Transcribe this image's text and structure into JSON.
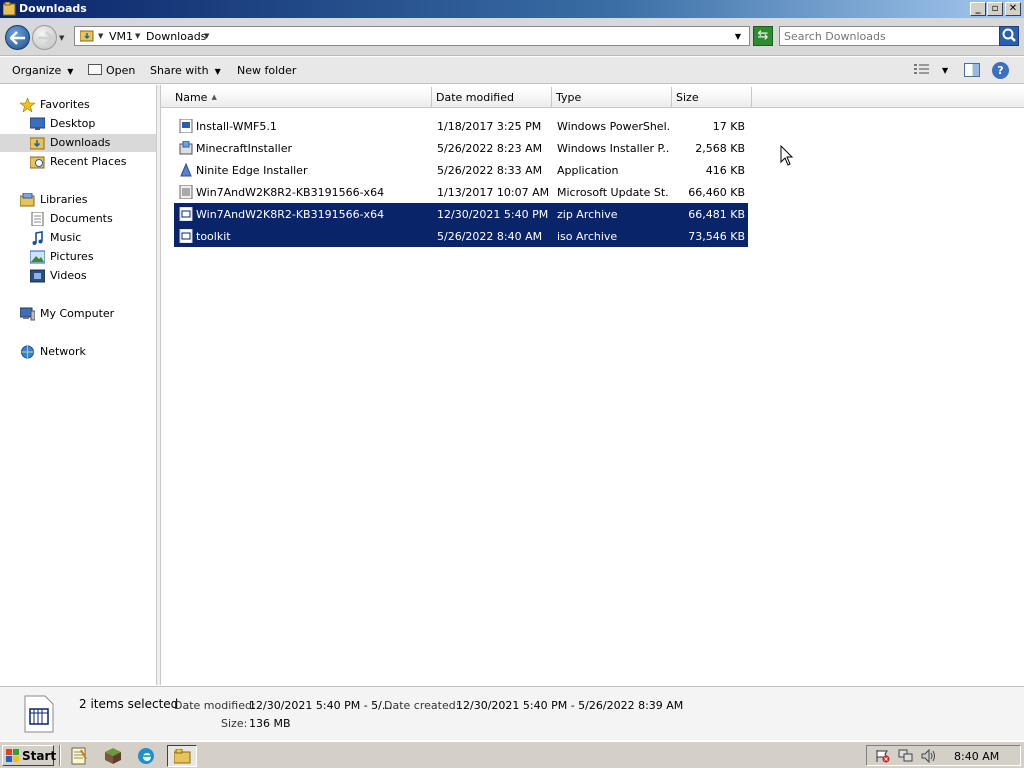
{
  "window": {
    "title": "Downloads"
  },
  "nav": {
    "back_icon": "back-arrow-icon",
    "forward_icon": "forward-arrow-icon"
  },
  "address": {
    "crumbs": [
      "VM1",
      "Downloads"
    ]
  },
  "search": {
    "placeholder": "Search Downloads"
  },
  "toolbar": {
    "organize": "Organize",
    "open": "Open",
    "share_with": "Share with",
    "new_folder": "New folder"
  },
  "sidebar": {
    "favorites": "Favorites",
    "desktop": "Desktop",
    "downloads": "Downloads",
    "recent_places": "Recent Places",
    "libraries": "Libraries",
    "documents": "Documents",
    "music": "Music",
    "pictures": "Pictures",
    "videos": "Videos",
    "my_computer": "My Computer",
    "network": "Network",
    "selected": "downloads"
  },
  "columns": {
    "name": "Name",
    "date_modified": "Date modified",
    "type": "Type",
    "size": "Size"
  },
  "files": [
    {
      "name": "Install-WMF5.1",
      "date": "1/18/2017 3:25 PM",
      "type": "Windows PowerShel...",
      "size": "17 KB",
      "icon": "powershell-script-icon",
      "selected": false
    },
    {
      "name": "MinecraftInstaller",
      "date": "5/26/2022 8:23 AM",
      "type": "Windows Installer P...",
      "size": "2,568 KB",
      "icon": "installer-package-icon",
      "selected": false
    },
    {
      "name": "Ninite Edge Installer",
      "date": "5/26/2022 8:33 AM",
      "type": "Application",
      "size": "416 KB",
      "icon": "application-icon",
      "selected": false
    },
    {
      "name": "Win7AndW2K8R2-KB3191566-x64",
      "date": "1/13/2017 10:07 AM",
      "type": "Microsoft Update St...",
      "size": "66,460 KB",
      "icon": "update-package-icon",
      "selected": false
    },
    {
      "name": "Win7AndW2K8R2-KB3191566-x64",
      "date": "12/30/2021 5:40 PM",
      "type": "zip Archive",
      "size": "66,481 KB",
      "icon": "archive-icon",
      "selected": true
    },
    {
      "name": "toolkit",
      "date": "5/26/2022 8:40 AM",
      "type": "iso Archive",
      "size": "73,546 KB",
      "icon": "archive-icon",
      "selected": true
    }
  ],
  "details": {
    "count": "2 items selected",
    "date_modified_label": "Date modified:",
    "date_modified_value": "12/30/2021 5:40 PM - 5/...",
    "date_created_label": "Date created:",
    "date_created_value": "12/30/2021 5:40 PM - 5/26/2022 8:39 AM",
    "size_label": "Size:",
    "size_value": "136 MB"
  },
  "taskbar": {
    "start": "Start",
    "clock": "8:40 AM"
  },
  "colors": {
    "selection": "#0a246a",
    "title_start": "#0a246a",
    "title_end": "#a6caf0"
  }
}
